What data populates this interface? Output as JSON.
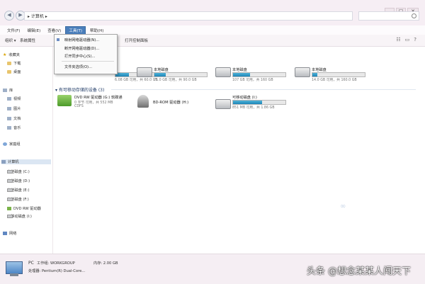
{
  "window": {
    "address_path": "▸ 计算机 ▸",
    "controls": {
      "minimize": "–",
      "maximize": "□",
      "close": "✕"
    }
  },
  "menubar": {
    "items": [
      "文件(F)",
      "编辑(E)",
      "查看(V)",
      "工具(T)",
      "帮助(H)"
    ],
    "active_index": 3
  },
  "toolbar": {
    "organize": "组织 ▾",
    "system_props": "系统属性",
    "open_control_panel": "打开控制面板"
  },
  "tools_menu": {
    "items": [
      "映射网络驱动器(N)...",
      "断开网络驱动器(D)...",
      "打开同步中心(S)...",
      "文件夹选项(O)..."
    ]
  },
  "sidebar": {
    "favorites": "收藏夹",
    "favorites_items": [
      "下载",
      "桌面"
    ],
    "libraries": "库",
    "library_items": [
      "视频",
      "图片",
      "文档",
      "音乐"
    ],
    "homegroup": "家庭组",
    "computer": "计算机",
    "computer_items": [
      "本地磁盘 (C:)",
      "本地磁盘 (D:)",
      "本地磁盘 (E:)",
      "本地磁盘 (F:)",
      "DVD RW 驱动器",
      "可移动磁盘 (I:)"
    ],
    "network": "网络"
  },
  "hard_disks": [
    {
      "label": "",
      "fill": 0.25,
      "size": "6.08 GB 可用，共 60.0 GB"
    },
    {
      "label": "本地磁盘",
      "fill": 0.21,
      "size": "71.0 GB 可用，共 90.0 GB"
    },
    {
      "label": "本地磁盘",
      "fill": 0.33,
      "size": "107 GB 可用，共 160 GB"
    },
    {
      "label": "本地磁盘",
      "fill": 0.09,
      "size": "14.0 GB 可用，共 160.0 GB"
    }
  ],
  "removable_section": "▾ 有可移动存储的设备 (3)",
  "removable": [
    {
      "label": "DVD RW 驱动器 (G:) 软碟通",
      "size_line1": "0 字节 可用，共 552 MB",
      "size_line2": "CDFS"
    },
    {
      "label": "BD-ROM 驱动器 (H:)"
    },
    {
      "label": "可移动磁盘 (I:)",
      "fill": 0.55,
      "size": "851 MB 可用，共 1.86 GB"
    }
  ],
  "details": {
    "name": "PC",
    "workgroup": "工作组: WORKGROUP",
    "memory": "内存: 2.00 GB",
    "processor": "处理器: Pentium(R) Dual-Core..."
  },
  "watermark": "头条 @想念某某人闯天下"
}
